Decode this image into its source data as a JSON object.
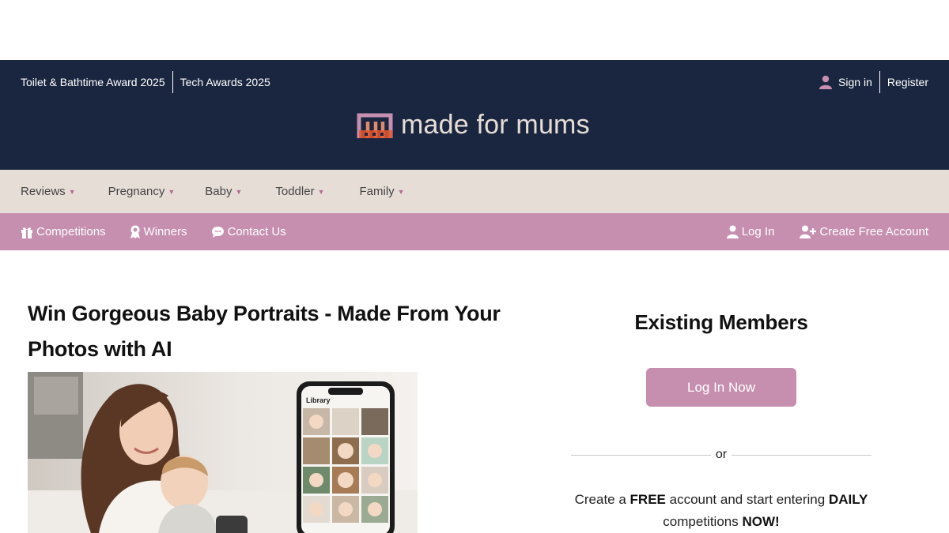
{
  "header": {
    "award_links": [
      "Toilet & Bathtime Award 2025",
      "Tech Awards 2025"
    ],
    "sign_in": "Sign in",
    "register": "Register",
    "logo_text": "made for mums"
  },
  "main_nav": {
    "items": [
      "Reviews",
      "Pregnancy",
      "Baby",
      "Toddler",
      "Family"
    ]
  },
  "sub_nav": {
    "competitions": "Competitions",
    "winners": "Winners",
    "contact": "Contact Us",
    "log_in": "Log In",
    "create_account": "Create Free Account"
  },
  "article": {
    "title_line1": "Win Gorgeous Baby Portraits - Made From Your",
    "title_line2": "Photos with AI",
    "phone_header": "Library"
  },
  "members": {
    "heading": "Existing Members",
    "login_button": "Log In Now",
    "or": "or",
    "promo": {
      "p1": "Create a ",
      "b1": "FREE",
      "p2": " account and start entering ",
      "b2": "DAILY",
      "p3": " competitions ",
      "b3": "NOW!"
    }
  },
  "colors": {
    "header_bg": "#1a2640",
    "main_nav_bg": "#e6ddd6",
    "sub_nav_bg": "#c68fb0",
    "accent": "#b76b92"
  }
}
